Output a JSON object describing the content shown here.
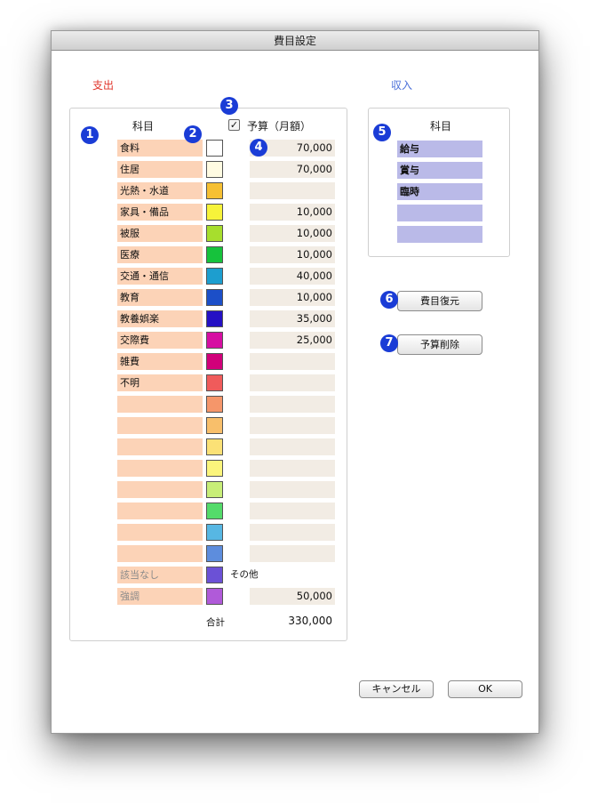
{
  "window": {
    "title": "費目設定"
  },
  "sections": {
    "expense_label": "支出",
    "income_label": "収入"
  },
  "expense": {
    "category_header": "科目",
    "budget_header": "予算（月額）",
    "budget_checkbox_checked": true,
    "rows": [
      {
        "name": "食料",
        "color": "#ffffff",
        "budget": "70,000"
      },
      {
        "name": "住居",
        "color": "#fffbe2",
        "budget": "70,000"
      },
      {
        "name": "光熱・水道",
        "color": "#f6c033",
        "budget": ""
      },
      {
        "name": "家具・備品",
        "color": "#f7f33a",
        "budget": "10,000"
      },
      {
        "name": "被服",
        "color": "#a7de2d",
        "budget": "10,000"
      },
      {
        "name": "医療",
        "color": "#16c23c",
        "budget": "10,000"
      },
      {
        "name": "交通・通信",
        "color": "#1d9ecf",
        "budget": "40,000"
      },
      {
        "name": "教育",
        "color": "#1c4fc8",
        "budget": "10,000"
      },
      {
        "name": "教養娯楽",
        "color": "#2410c4",
        "budget": "35,000"
      },
      {
        "name": "交際費",
        "color": "#d60ea2",
        "budget": "25,000"
      },
      {
        "name": "雑費",
        "color": "#d1007a",
        "budget": ""
      },
      {
        "name": "不明",
        "color": "#f05b5b",
        "budget": ""
      },
      {
        "name": "",
        "color": "#f5966a",
        "budget": ""
      },
      {
        "name": "",
        "color": "#f8bf6b",
        "budget": ""
      },
      {
        "name": "",
        "color": "#fbe176",
        "budget": ""
      },
      {
        "name": "",
        "color": "#fbf57c",
        "budget": ""
      },
      {
        "name": "",
        "color": "#c8ee78",
        "budget": ""
      },
      {
        "name": "",
        "color": "#54db6a",
        "budget": ""
      },
      {
        "name": "",
        "color": "#57b7e3",
        "budget": ""
      },
      {
        "name": "",
        "color": "#5d8ddd",
        "budget": ""
      }
    ],
    "none_row": {
      "name": "該当なし",
      "color": "#6b51d6",
      "label": "その他"
    },
    "emphasis_row": {
      "name": "強調",
      "color": "#b05ad9",
      "budget": "50,000"
    },
    "total_label": "合計",
    "total_value": "330,000"
  },
  "income": {
    "category_header": "科目",
    "rows": [
      {
        "name": "給与"
      },
      {
        "name": "賞与"
      },
      {
        "name": "臨時"
      },
      {
        "name": ""
      },
      {
        "name": ""
      }
    ]
  },
  "buttons": {
    "restore": "費目復元",
    "delete_budget": "予算削除",
    "cancel": "キャンセル",
    "ok": "OK"
  },
  "badges": [
    "1",
    "2",
    "3",
    "4",
    "5",
    "6",
    "7"
  ],
  "colors": {
    "expense_label": "#e0352b",
    "income_label": "#4a6fd8",
    "badge": "#1a3cd6"
  }
}
